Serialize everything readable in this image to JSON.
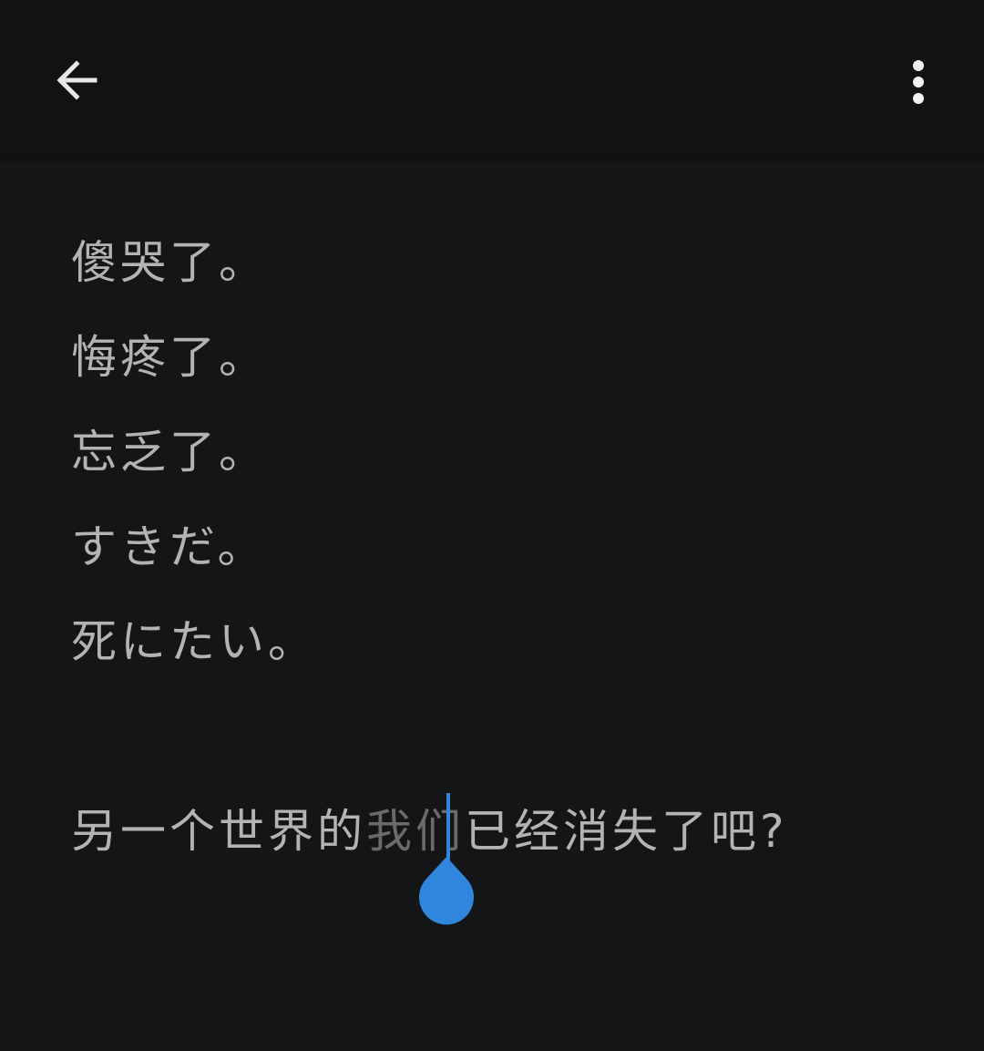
{
  "toolbar": {
    "back_icon": "arrow-back-icon",
    "more_icon": "more-vertical-icon"
  },
  "note": {
    "lines": [
      "傻哭了。",
      "悔疼了。",
      "忘乏了。",
      "すきだ。",
      "死にたい。"
    ],
    "last_line": {
      "before": "另一个世界的",
      "dim": "我们",
      "after": "已经消失了吧?"
    }
  },
  "colors": {
    "background": "#141517",
    "toolbar": "#121212",
    "text": "#b3b3b3",
    "cursor": "#2f86dc"
  }
}
